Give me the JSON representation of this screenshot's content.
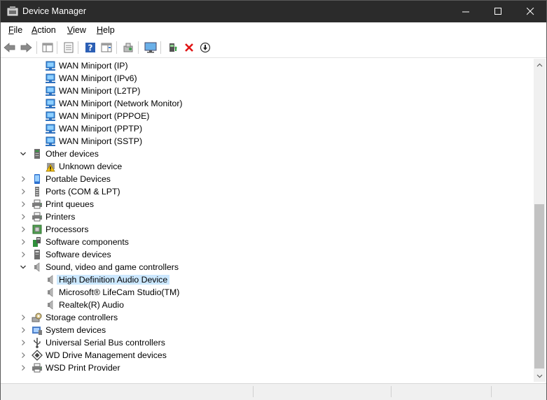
{
  "window": {
    "title": "Device Manager"
  },
  "menu": [
    {
      "label": "File",
      "accel": "F",
      "rest": "ile"
    },
    {
      "label": "Action",
      "accel": "A",
      "rest": "ction"
    },
    {
      "label": "View",
      "accel": "V",
      "rest": "iew"
    },
    {
      "label": "Help",
      "accel": "H",
      "rest": "elp"
    }
  ],
  "toolbar_icons": [
    "back-arrow-icon",
    "forward-arrow-icon",
    "show-hide-tree-icon",
    "properties-icon",
    "help-icon",
    "action-pane-icon",
    "scan-hardware-icon",
    "monitor-icon",
    "update-driver-icon",
    "uninstall-x-icon",
    "disable-device-icon"
  ],
  "tree": [
    {
      "label": "WAN Miniport (IP)",
      "level": 2,
      "icon": "network-adapter-icon"
    },
    {
      "label": "WAN Miniport (IPv6)",
      "level": 2,
      "icon": "network-adapter-icon"
    },
    {
      "label": "WAN Miniport (L2TP)",
      "level": 2,
      "icon": "network-adapter-icon"
    },
    {
      "label": "WAN Miniport (Network Monitor)",
      "level": 2,
      "icon": "network-adapter-icon"
    },
    {
      "label": "WAN Miniport (PPPOE)",
      "level": 2,
      "icon": "network-adapter-icon"
    },
    {
      "label": "WAN Miniport (PPTP)",
      "level": 2,
      "icon": "network-adapter-icon"
    },
    {
      "label": "WAN Miniport (SSTP)",
      "level": 2,
      "icon": "network-adapter-icon"
    },
    {
      "label": "Other devices",
      "level": 1,
      "expanded": true,
      "icon": "other-devices-icon"
    },
    {
      "label": "Unknown device",
      "level": 2,
      "icon": "warning-device-icon"
    },
    {
      "label": "Portable Devices",
      "level": 1,
      "expanded": false,
      "icon": "portable-device-icon"
    },
    {
      "label": "Ports (COM & LPT)",
      "level": 1,
      "expanded": false,
      "icon": "port-icon"
    },
    {
      "label": "Print queues",
      "level": 1,
      "expanded": false,
      "icon": "printer-icon"
    },
    {
      "label": "Printers",
      "level": 1,
      "expanded": false,
      "icon": "printer-icon"
    },
    {
      "label": "Processors",
      "level": 1,
      "expanded": false,
      "icon": "processor-icon"
    },
    {
      "label": "Software components",
      "level": 1,
      "expanded": false,
      "icon": "software-component-icon"
    },
    {
      "label": "Software devices",
      "level": 1,
      "expanded": false,
      "icon": "software-device-icon"
    },
    {
      "label": "Sound, video and game controllers",
      "level": 1,
      "expanded": true,
      "icon": "speaker-icon"
    },
    {
      "label": "High Definition Audio Device",
      "level": 2,
      "selected": true,
      "icon": "speaker-icon"
    },
    {
      "label": "Microsoft® LifeCam Studio(TM)",
      "level": 2,
      "icon": "speaker-icon"
    },
    {
      "label": "Realtek(R) Audio",
      "level": 2,
      "icon": "speaker-icon"
    },
    {
      "label": "Storage controllers",
      "level": 1,
      "expanded": false,
      "icon": "storage-controller-icon"
    },
    {
      "label": "System devices",
      "level": 1,
      "expanded": false,
      "icon": "system-device-icon"
    },
    {
      "label": "Universal Serial Bus controllers",
      "level": 1,
      "expanded": false,
      "icon": "usb-icon"
    },
    {
      "label": "WD Drive Management devices",
      "level": 1,
      "expanded": false,
      "icon": "wd-diamond-icon"
    },
    {
      "label": "WSD Print Provider",
      "level": 1,
      "expanded": false,
      "icon": "printer-icon"
    }
  ],
  "colors": {
    "titlebar": "#2b2b2b",
    "selection": "#cce8ff",
    "accent": "#3c7fd9"
  }
}
